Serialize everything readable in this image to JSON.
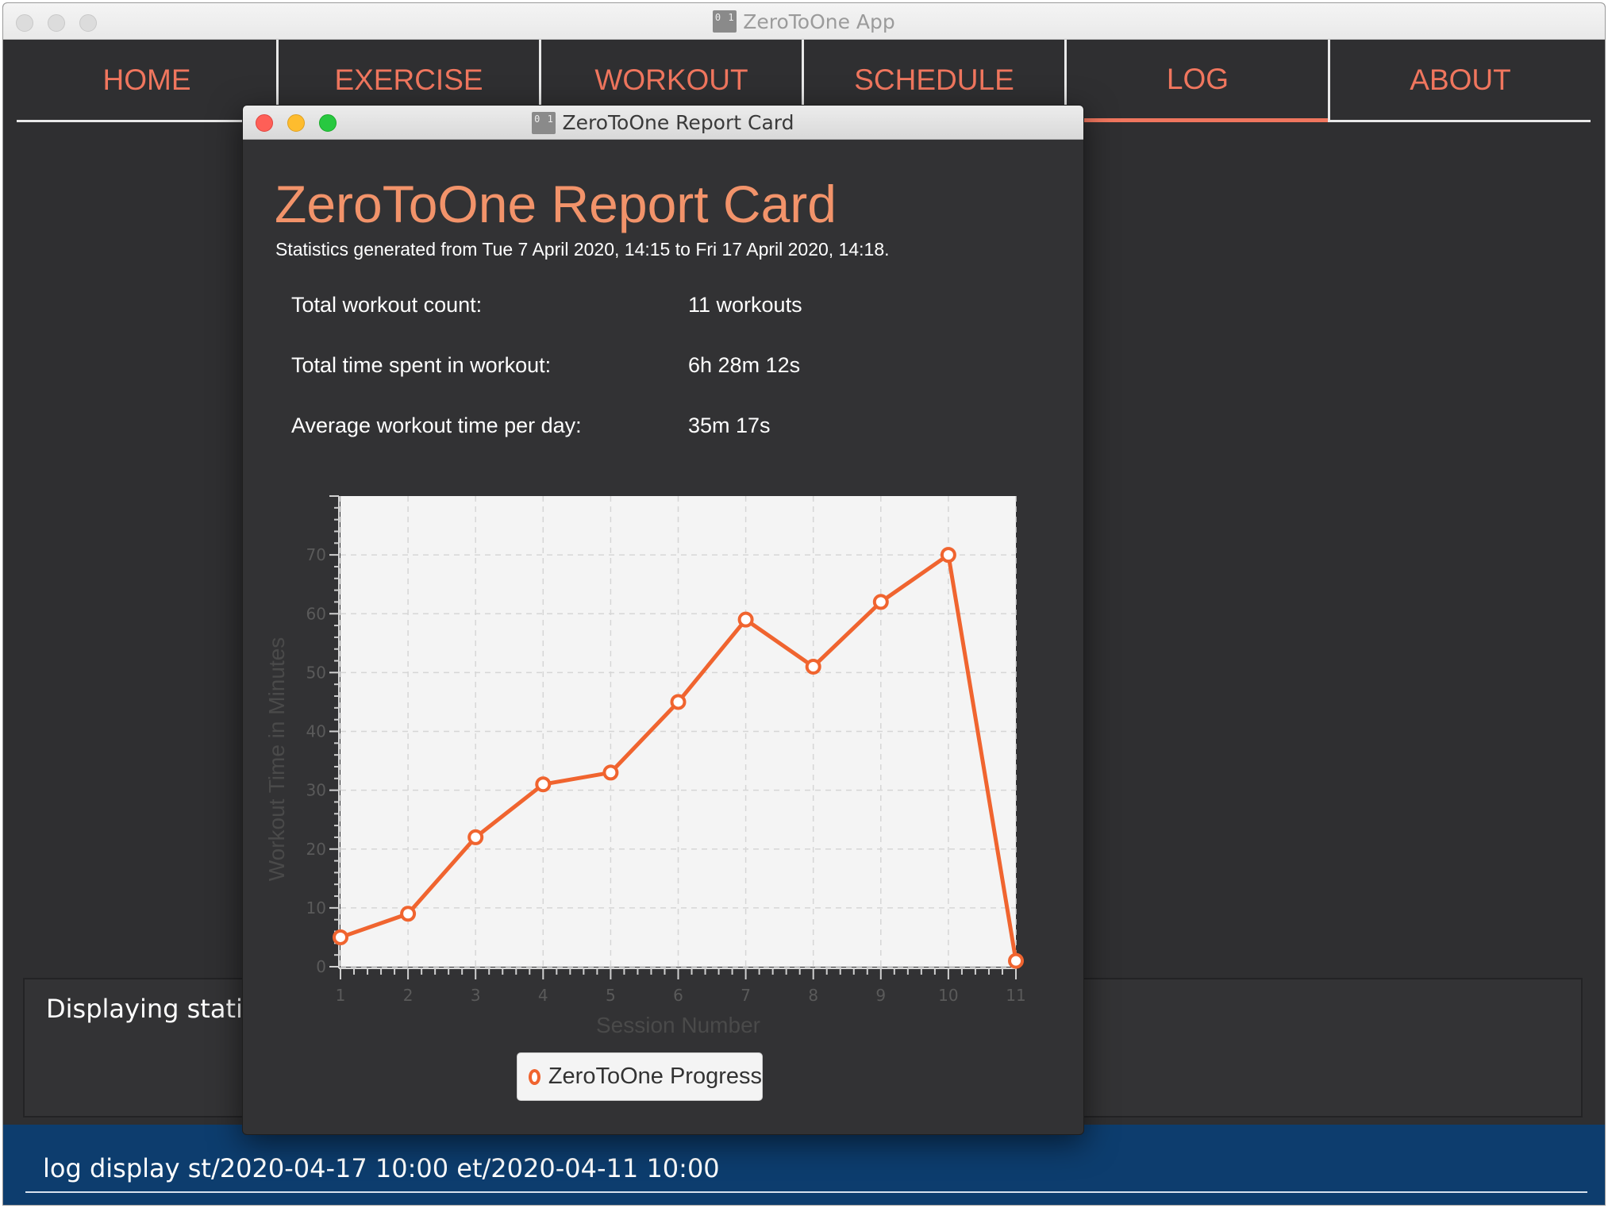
{
  "app": {
    "title": "ZeroToOne App",
    "icon_text": "0 1",
    "window_controls": [
      "close-icon",
      "minimize-icon",
      "zoom-icon"
    ]
  },
  "tabs": [
    {
      "label": "HOME",
      "active": false
    },
    {
      "label": "EXERCISE",
      "active": false
    },
    {
      "label": "WORKOUT",
      "active": false
    },
    {
      "label": "SCHEDULE",
      "active": false
    },
    {
      "label": "LOG",
      "active": true
    },
    {
      "label": "ABOUT",
      "active": false
    }
  ],
  "result_display": {
    "text": "Displaying statistics"
  },
  "command_box": {
    "value": "log display st/2020-04-17 10:00 et/2020-04-11 10:00"
  },
  "report_window": {
    "title": "ZeroToOne Report Card",
    "heading": "ZeroToOne Report Card",
    "subtitle": "Statistics generated from Tue 7 April 2020, 14:15 to Fri 17 April 2020, 14:18.",
    "stats": [
      {
        "label": "Total workout count:",
        "value": "11 workouts"
      },
      {
        "label": "Total time spent in workout:",
        "value": "6h 28m 12s"
      },
      {
        "label": "Average workout time per day:",
        "value": "35m 17s"
      }
    ]
  },
  "colors": {
    "accent": "#f0765e",
    "heading": "#f2936a",
    "series": "#f0642f",
    "command_bar": "#0d3d6e",
    "background": "#2f2f31"
  },
  "chart_data": {
    "type": "line",
    "x": [
      1,
      2,
      3,
      4,
      5,
      6,
      7,
      8,
      9,
      10,
      11
    ],
    "series": [
      {
        "name": "ZeroToOne Progress",
        "values": [
          5,
          9,
          22,
          31,
          33,
          45,
          59,
          51,
          62,
          70,
          1
        ]
      }
    ],
    "xlabel": "Session Number",
    "ylabel": "Workout Time in Minutes",
    "xticks": [
      1,
      2,
      3,
      4,
      5,
      6,
      7,
      8,
      9,
      10,
      11
    ],
    "yticks": [
      0,
      10,
      20,
      30,
      40,
      50,
      60,
      70
    ],
    "xlim": [
      1,
      11
    ],
    "ylim": [
      0,
      80
    ],
    "grid": true,
    "legend": "bottom-center"
  }
}
